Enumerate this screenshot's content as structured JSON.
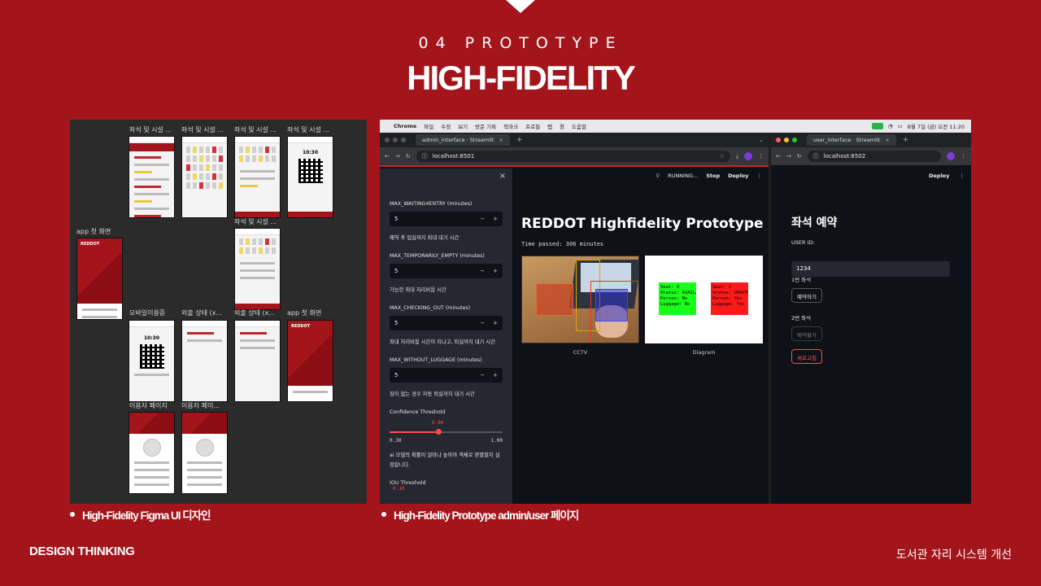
{
  "slide": {
    "section": "04 PROTOTYPE",
    "title": "HIGH-FIDELITY",
    "footer_left": "DESIGN THINKING",
    "footer_right": "도서관 자리 시스템 개선"
  },
  "figma": {
    "caption": "High-Fidelity Figma UI 디자인",
    "frames": [
      "좌석 및 시설 ...",
      "좌석 및 시설 ...",
      "좌석 및 시설 ...",
      "좌석 및 시설 ...",
      "좌석 및 시설 ...",
      "app 첫 화면",
      "모바일이용증",
      "외출 상태 (x...",
      "외출 상태 (x...",
      "app 첫 화면",
      "이용자 페이지",
      "이용자 페이..."
    ],
    "qr_time": "10:30",
    "brand": "REDDOT"
  },
  "prototype": {
    "caption": "High-Fidelity Prototype admin/user 페이지",
    "mac_menu": [
      "Chrome",
      "파일",
      "수정",
      "보기",
      "방문 기록",
      "북마크",
      "프로필",
      "탭",
      "창",
      "도움말"
    ],
    "mac_clock": "8월 7일 (금) 오전 11:20",
    "admin": {
      "tab_title": "admin_interface · Streamlit",
      "url": "localhost:8501",
      "run_status": "RUNNING...",
      "stop": "Stop",
      "deploy": "Deploy",
      "settings": [
        {
          "label": "MAX_WAITING4ENTRY (minutes)",
          "value": "5",
          "help": "예약 후 입실까지 최대 대기 시간"
        },
        {
          "label": "MAX_TEMPORARILY_EMPTY (minutes)",
          "value": "5",
          "help": "가능한 최대 자리비움 시간"
        },
        {
          "label": "MAX_CHECKING_OUT (minutes)",
          "value": "5",
          "help": "최대 자리비움 시간이 지나고, 퇴실까지 대기 시간"
        },
        {
          "label": "MAX_WITHOUT_LUGGAGE (minutes)",
          "value": "5",
          "help": "짐이 없는 경우 자동 퇴실까지 대기 시간"
        }
      ],
      "minus": "−",
      "plus": "+",
      "confidence": {
        "label": "Confidence Threshold",
        "value": "0.60",
        "min": "0.30",
        "max": "1.00",
        "fraction": 0.4286
      },
      "confidence_help": "ai 모델의 확률이 얼마나 높아야 객체로 판별할지 설정합니다.",
      "iou": {
        "label": "IOU Threshold",
        "value": "0.10"
      },
      "app_title": "REDDOT Highfidelity Prototype",
      "time_passed": "Time passed: 306 minutes",
      "cctv_caption": "CCTV",
      "diagram_caption": "Diagram",
      "seats": [
        {
          "lines": [
            "Seat: 0",
            "Status: AVAILABLE",
            "Person: No",
            "Luggage: No"
          ],
          "color": "#19ff19"
        },
        {
          "lines": [
            "Seat: 1",
            "Status: UNAUTHORIZED",
            "Person: Yes",
            "Luggage: Yes"
          ],
          "color": "#ff1a1a"
        }
      ]
    },
    "user": {
      "tab_title": "user_interface · Streamlit",
      "url": "localhost:8502",
      "deploy": "Deploy",
      "title": "좌석 예약",
      "user_id_label": "USER ID:",
      "user_id_value": "1234",
      "seat1_label": "1번 좌석",
      "seat1_button": "예약하기",
      "seat2_label": "2번 좌석",
      "seat2_button": "예약불가",
      "refresh_button": "새로고침"
    }
  },
  "colors": {
    "brand_red": "#a3141b",
    "streamlit_red": "#ff4b4b",
    "streamlit_bg": "#0e1117",
    "sidebar_bg": "#262730"
  }
}
